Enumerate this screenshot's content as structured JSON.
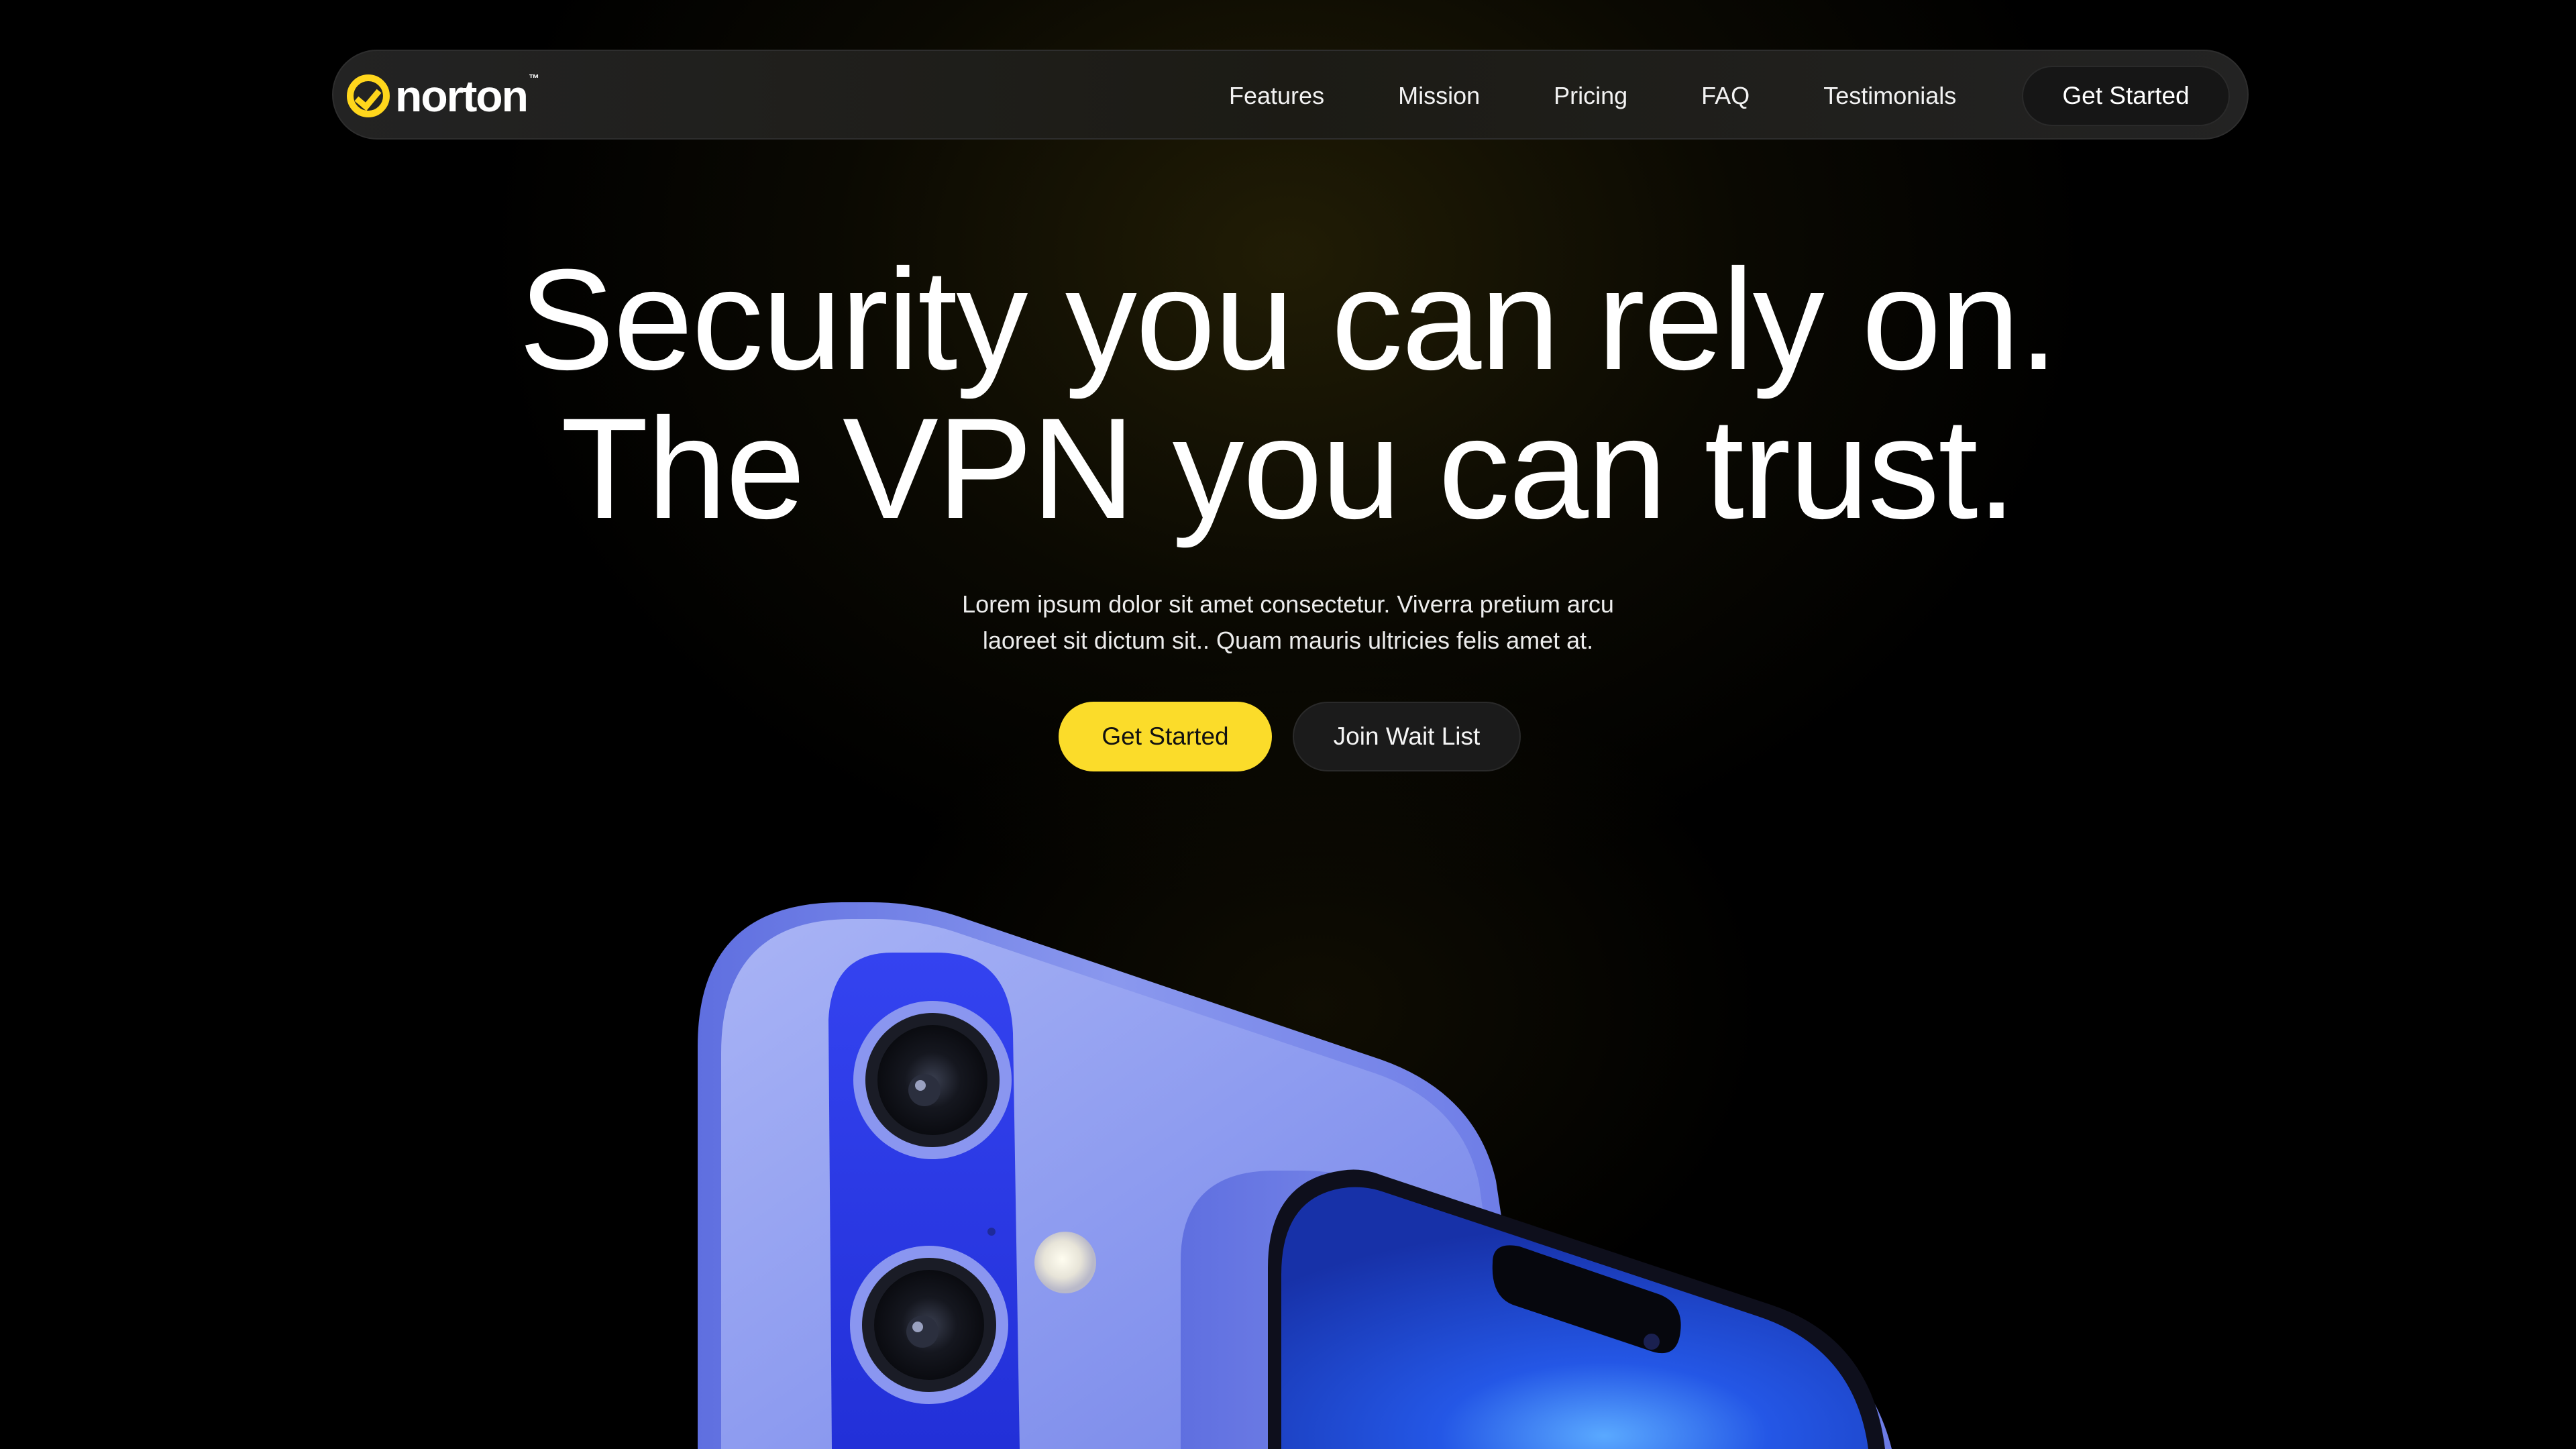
{
  "brand": {
    "name": "norton",
    "trademark": "™",
    "accent_color": "#fbdc2a"
  },
  "nav": {
    "links": [
      {
        "label": "Features"
      },
      {
        "label": "Mission"
      },
      {
        "label": "Pricing"
      },
      {
        "label": "FAQ"
      },
      {
        "label": "Testimonials"
      }
    ],
    "cta_label": "Get Started"
  },
  "hero": {
    "title_line1": "Security you can rely on.",
    "title_line2": "The VPN you can trust.",
    "subtitle_line1": "Lorem ipsum dolor sit amet consectetur. Viverra pretium arcu",
    "subtitle_line2": "laoreet sit dictum sit.. Quam mauris ultricies felis amet at.",
    "primary_button": "Get Started",
    "secondary_button": "Join Wait List"
  },
  "colors": {
    "background": "#000000",
    "phone_body": "#8f9ef0",
    "phone_screen": "#1b3fd6"
  }
}
